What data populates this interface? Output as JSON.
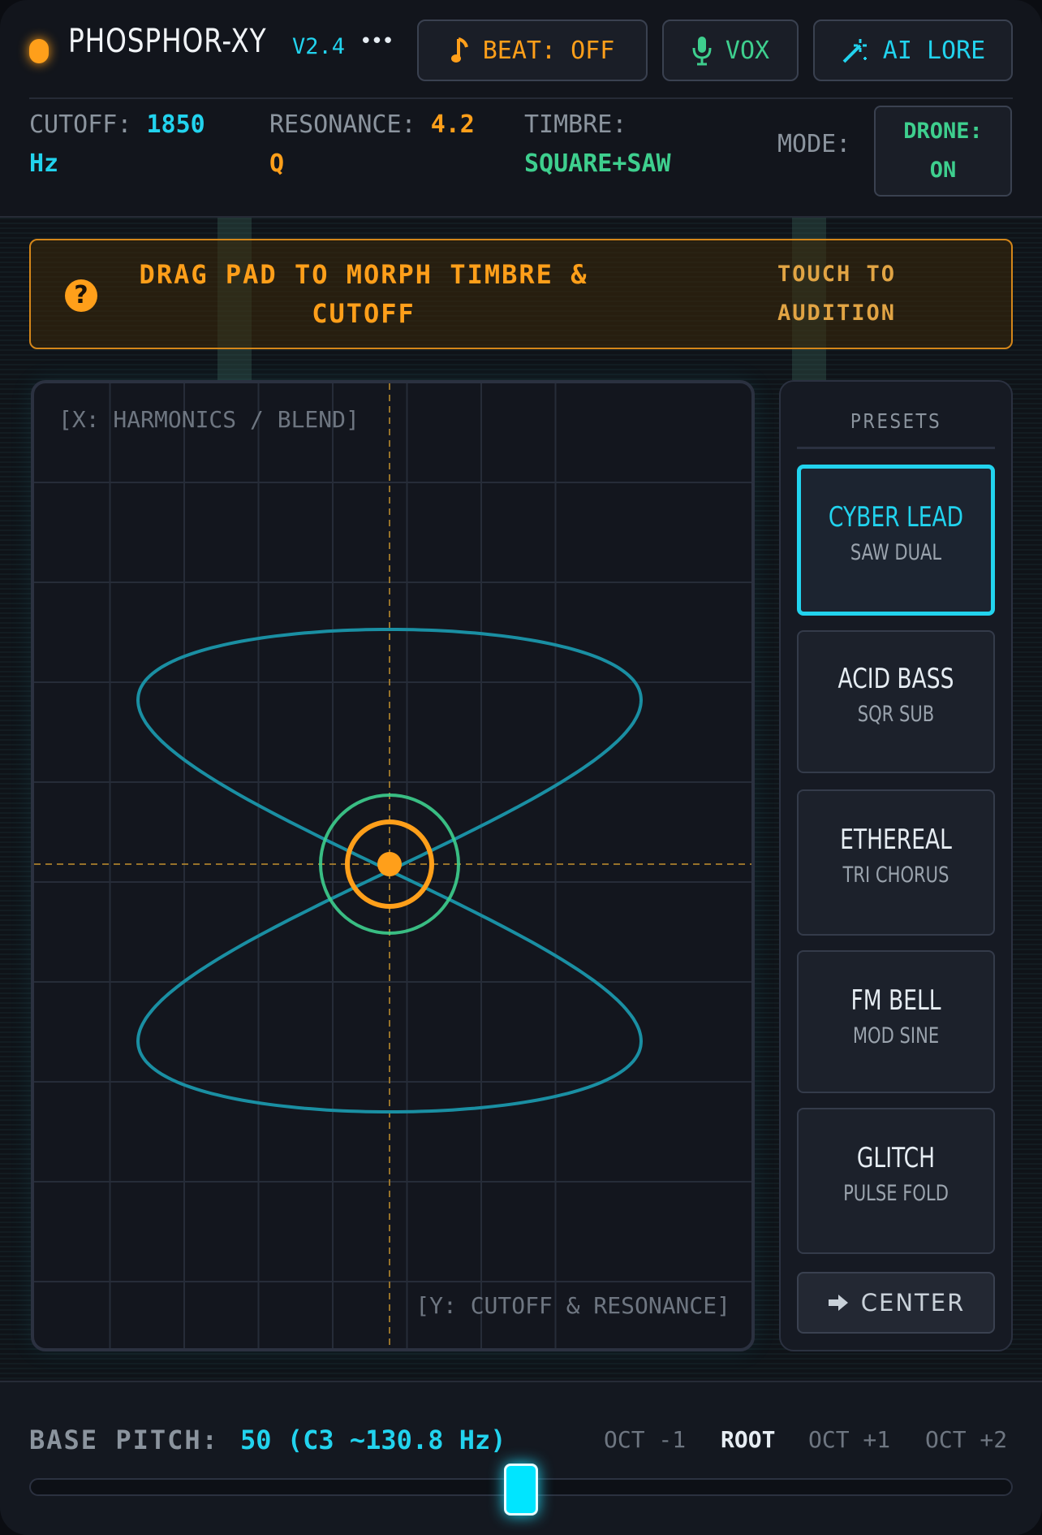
{
  "header": {
    "title": "PHOSPHOR-XY",
    "version": "V2.4",
    "more_glyph": "•••",
    "beat_label": "BEAT: OFF",
    "vox_label": "VOX",
    "ai_label": "AI LORE"
  },
  "readouts": {
    "cutoff_label": "CUTOFF:",
    "cutoff_value": "1850",
    "cutoff_unit": "Hz",
    "resonance_label": "RESONANCE:",
    "resonance_value": "4.2",
    "resonance_unit": "Q",
    "timbre_label": "TIMBRE:",
    "timbre_value": "SQUARE+SAW",
    "mode_label": "MODE:",
    "drone_line1": "DRONE:",
    "drone_line2": "ON"
  },
  "hint": {
    "icon": "?",
    "main_line1": "DRAG PAD TO MORPH TIMBRE &",
    "main_line2": "CUTOFF",
    "sub_line1": "TOUCH TO",
    "sub_line2": "AUDITION"
  },
  "pad": {
    "x_label": "[X: HARMONICS / BLEND]",
    "y_label": "[Y: CUTOFF & RESONANCE]",
    "cursor_x": 0.5,
    "cursor_y": 0.5
  },
  "presets": {
    "title": "PRESETS",
    "items": [
      {
        "name": "CYBER LEAD",
        "sub": "SAW DUAL",
        "active": true
      },
      {
        "name": "ACID BASS",
        "sub": "SQR SUB",
        "active": false
      },
      {
        "name": "ETHEREAL",
        "sub": "TRI CHORUS",
        "active": false
      },
      {
        "name": "FM BELL",
        "sub": "MOD SINE",
        "active": false
      },
      {
        "name": "GLITCH",
        "sub": "PULSE FOLD",
        "active": false
      }
    ],
    "center_label": "CENTER"
  },
  "bottom": {
    "base_pitch_label": "BASE PITCH:",
    "base_pitch_value": "50 (C3 ~130.8 Hz)",
    "octaves": [
      "OCT -1",
      "ROOT",
      "OCT +1",
      "OCT +2"
    ],
    "active_octave": "ROOT",
    "slider_value": 0.5
  },
  "colors": {
    "accent_cyan": "#22d3ee",
    "accent_orange": "#ff9f1a",
    "accent_green": "#3ecf8e",
    "trace": "#1a8fa3"
  }
}
